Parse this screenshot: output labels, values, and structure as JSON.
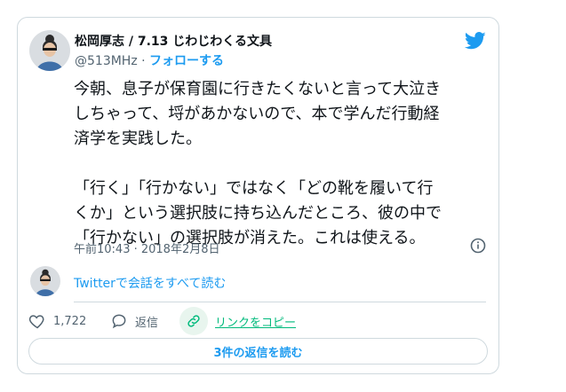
{
  "author": {
    "name": "松岡厚志 / 7.13 じわじわくる文具",
    "handle": "@513MHz",
    "separator": "·",
    "follow_label": "フォローする"
  },
  "tweet": {
    "paragraph1_lines": [
      "今朝、息子が保育園に行きたくないと言って大泣き",
      "しちゃって、埒があかないので、本で学んだ行動経",
      "済学を実践した。"
    ],
    "paragraph2_lines": [
      "「行く」「行かない」ではなく「どの靴を履いて行",
      "くか」という選択肢に持ち込んだところ、彼の中で",
      "「行かない」の選択肢が消えた。これは使える。"
    ],
    "timestamp": "午前10:43 · 2018年2月8日"
  },
  "thread": {
    "link_label": "Twitterで会話をすべて読む"
  },
  "actions": {
    "like_count": "1,722",
    "reply_label": "返信",
    "copy_link_label": "リンクをコピー"
  },
  "replies_button_label": "3件の返信を読む",
  "colors": {
    "accent_blue": "#1d9bf0",
    "copy_green": "#00ba7c",
    "secondary_text": "#536471",
    "border": "#cfd9de"
  },
  "icons": [
    "avatar",
    "twitter-bird-icon",
    "info-icon",
    "heart-icon",
    "reply-bubble-icon",
    "link-icon"
  ]
}
